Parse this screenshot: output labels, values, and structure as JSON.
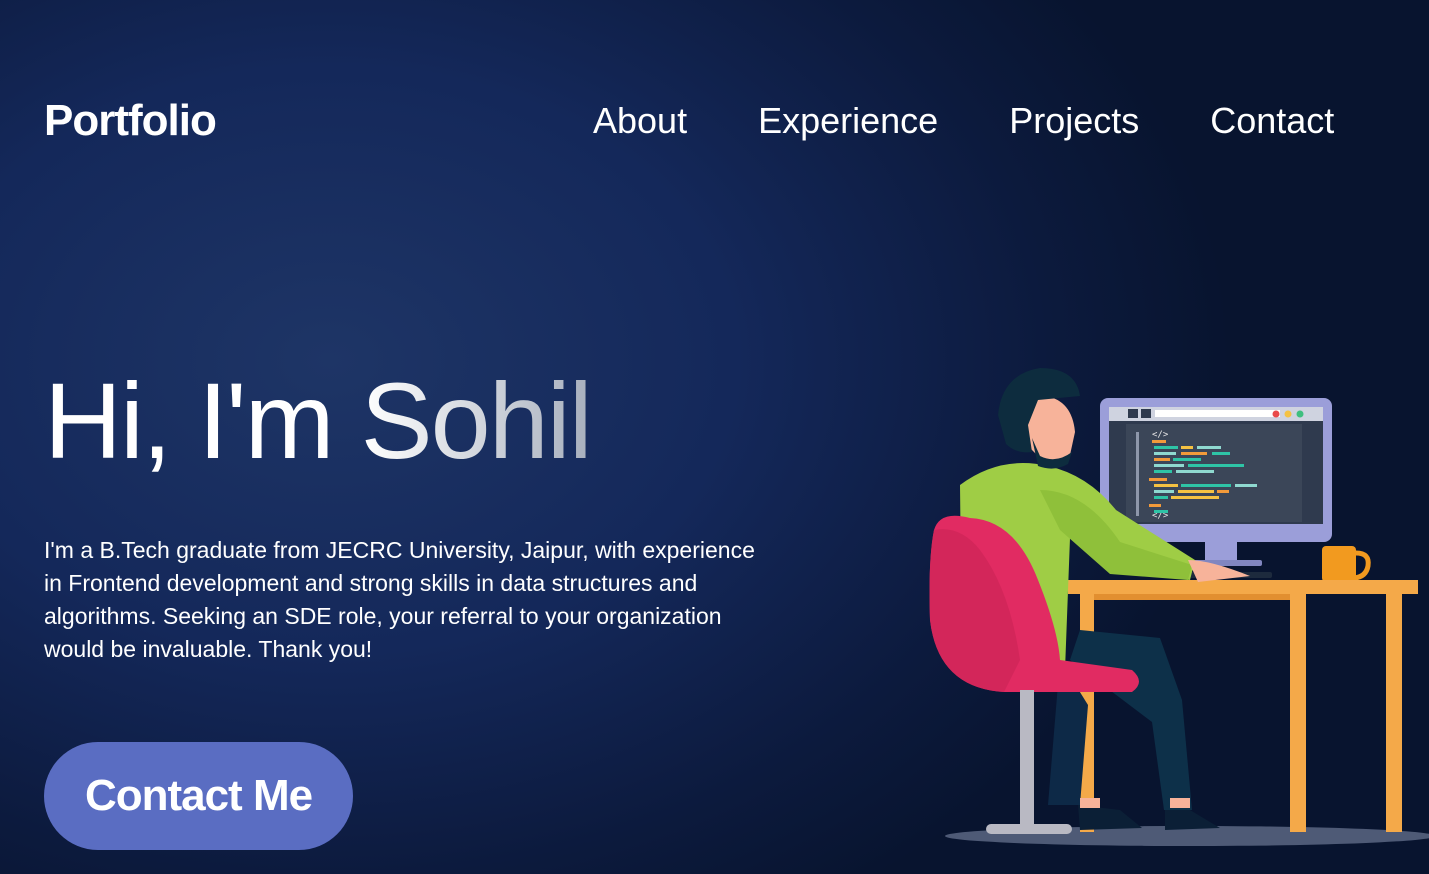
{
  "header": {
    "logo": "Portfolio",
    "nav": [
      {
        "label": "About"
      },
      {
        "label": "Experience"
      },
      {
        "label": "Projects"
      },
      {
        "label": "Contact"
      }
    ]
  },
  "hero": {
    "title": "Hi, I'm Sohil",
    "description": "I'm a B.Tech graduate from JECRC University, Jaipur, with experience in Frontend development and strong skills in data structures and algorithms. Seeking an SDE role, your referral to your organization would be invaluable. Thank you!",
    "cta_label": "Contact Me"
  },
  "illustration": {
    "code_tag_top": "</>",
    "code_tag_bottom": "</>"
  },
  "colors": {
    "background": "#0c1a3d",
    "button": "#5a6dc2",
    "desk": "#f4a949",
    "chair": "#e12b62",
    "shirt": "#9fcd45",
    "monitor_frame": "#9b9ed9"
  }
}
